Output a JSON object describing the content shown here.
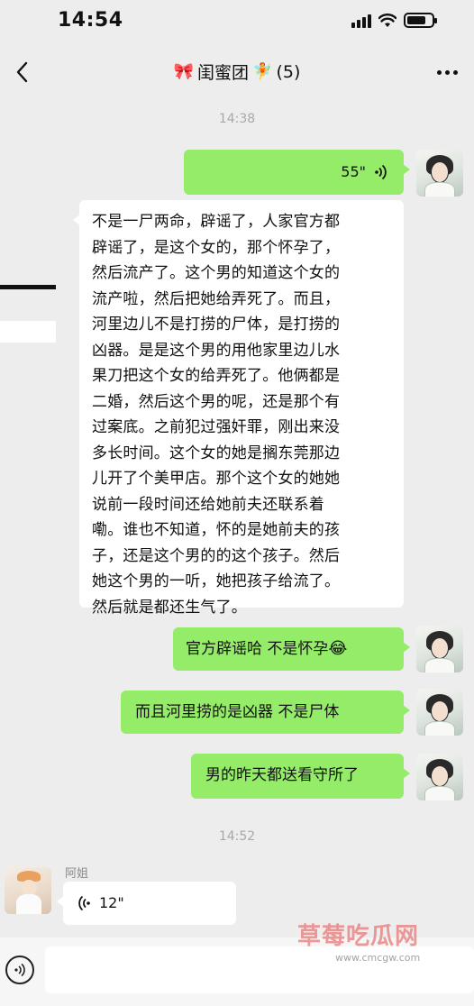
{
  "status_bar": {
    "time": "14:54",
    "battery_level": 0.75
  },
  "nav": {
    "left_emoji": "🎀",
    "title": "闺蜜团",
    "right_emoji": "🧚",
    "member_count": "(5)"
  },
  "messages": {
    "time1": "14:38",
    "voice_out": {
      "duration": "55\"",
      "icon": "voice-wave-icon"
    },
    "long_text": "不是一尸两命，辟谣了，人家官方都\n辟谣了，是这个女的，那个怀孕了，\n然后流产了。这个男的知道这个女的\n流产啦，然后把她给弄死了。而且，\n河里边儿不是打捞的尸体，是打捞的\n凶器。是是这个男的用他家里边儿水\n果刀把这个女的给弄死了。他俩都是\n二婚，然后这个男的呢，还是那个有\n过案底。之前犯过强奸罪，刚出来没\n多长时间。这个女的她是搁东莞那边\n儿开了个美甲店。那个这个女的她她\n说前一段时间还给她前夫还联系着\n嘞。谁也不知道，怀的是她前夫的孩\n子，还是这个男的的这个孩子。然后\n她这个男的一听，她把孩子给流了。\n然后就是都还生气了。",
    "reply1": "官方辟谣哈   不是怀孕",
    "reply1_emoji": "😂",
    "reply2": "而且河里捞的是凶器   不是尸体",
    "reply3": "男的昨天都送看守所了",
    "time2": "14:52",
    "sender_name": "阿姐",
    "voice_in": {
      "duration": "12\""
    }
  },
  "watermark": {
    "text": "草莓吃瓜网",
    "url": "www.cmcgw.com"
  }
}
